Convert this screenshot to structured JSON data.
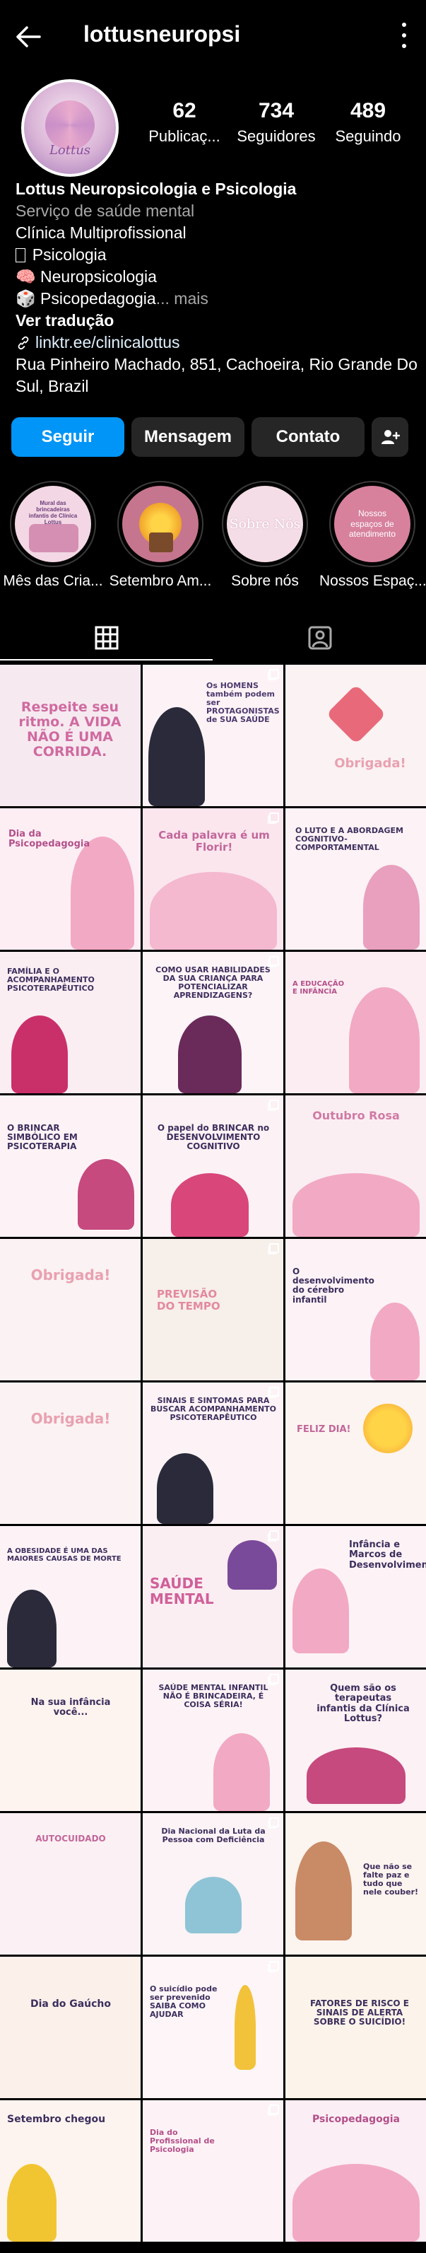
{
  "header": {
    "username": "lottusneuropsi",
    "back_icon": "arrow-left-icon",
    "more_icon": "kebab-menu-icon"
  },
  "stats": {
    "posts_count": "62",
    "posts_label": "Publicaç...",
    "followers_count": "734",
    "followers_label": "Seguidores",
    "following_count": "489",
    "following_label": "Seguindo"
  },
  "bio": {
    "name": "Lottus Neuropsicologia e Psicologia",
    "category": "Serviço de saúde mental",
    "line1": "Clínica Multiprofissional",
    "line2": " Psicologia",
    "line3": "🧠 Neuropsicologia",
    "line4_main": "🎲 Psicopedagogia",
    "line4_more": "... mais",
    "translate": "Ver tradução",
    "link": "linktr.ee/clinicalottus",
    "address": "Rua Pinheiro Machado, 851, Cachoeira, Rio Grande Do Sul, Brazil"
  },
  "actions": {
    "follow": "Seguir",
    "message": "Mensagem",
    "contact": "Contato",
    "add_user_icon": "person-add-icon"
  },
  "highlights": [
    {
      "label": "Mês das Cria...",
      "cover_text": "Mural das brincadeiras infantis de Clínica Lottus"
    },
    {
      "label": "Setembro Am...",
      "cover_text": ""
    },
    {
      "label": "Sobre nós",
      "cover_text": "Sobre Nós"
    },
    {
      "label": "Nossos Espaç...",
      "cover_text": "Nossos espaços de atendimento"
    }
  ],
  "tabs": {
    "grid_icon": "grid-icon",
    "tagged_icon": "tagged-person-icon"
  },
  "posts": [
    {
      "text": "Respeite seu ritmo. A VIDA NÃO É UMA CORRIDA.",
      "bg": "#f6eaf0",
      "fg": "#d06aa0"
    },
    {
      "text": "Os HOMENS também podem ser PROTAGONISTAS de SUA SAÚDE",
      "bg": "#fdf3f6",
      "fg": "#4b3a6e"
    },
    {
      "text": "Obrigada!",
      "bg": "#fbf2f3",
      "fg": "#e9a1b0"
    },
    {
      "text": "Dia da Psicopedagogia",
      "bg": "#fdeef4",
      "fg": "#b3508a"
    },
    {
      "text": "Cada palavra é um Florir!",
      "bg": "#fbe6ee",
      "fg": "#c2679a"
    },
    {
      "text": "O LUTO E A ABORDAGEM COGNITIVO-COMPORTAMENTAL",
      "bg": "#fdf2f5",
      "fg": "#3c2f5e"
    },
    {
      "text": "FAMÍLIA E O ACOMPANHAMENTO PSICOTERAPÊUTICO",
      "bg": "#fbeef3",
      "fg": "#3c2f5e"
    },
    {
      "text": "COMO USAR HABILIDADES DA SUA CRIANÇA PARA POTENCIALIZAR APRENDIZAGENS?",
      "bg": "#fdf4f7",
      "fg": "#3c2f5e"
    },
    {
      "text": "A EDUCAÇÃO E INFÂNCIA",
      "bg": "#fcedf2",
      "fg": "#b3508a"
    },
    {
      "text": "O BRINCAR SIMBÓLICO EM PSICOTERAPIA",
      "bg": "#fdf3f6",
      "fg": "#3c2f5e"
    },
    {
      "text": "O papel do BRINCAR no DESENVOLVIMENTO COGNITIVO",
      "bg": "#fcf1f4",
      "fg": "#3c2f5e"
    },
    {
      "text": "Outubro Rosa",
      "bg": "#fbeef2",
      "fg": "#d07aa5"
    },
    {
      "text": "Obrigada!",
      "bg": "#fbf2f3",
      "fg": "#e9a1b0"
    },
    {
      "text": "PREVISÃO DO TEMPO",
      "bg": "#f6efea",
      "fg": "#e4899f"
    },
    {
      "text": "O desenvolvimento do cérebro infantil",
      "bg": "#fdf3f6",
      "fg": "#3c2f5e"
    },
    {
      "text": "Obrigada!",
      "bg": "#fbf2f3",
      "fg": "#e9a1b0"
    },
    {
      "text": "SINAIS E SINTOMAS PARA BUSCAR ACOMPANHAMENTO PSICOTERAPÊUTICO",
      "bg": "#fdf3f6",
      "fg": "#3c2f5e"
    },
    {
      "text": "FELIZ DIA!",
      "bg": "#fcf4f0",
      "fg": "#c2679a"
    },
    {
      "text": "A OBESIDADE É UMA DAS MAIORES CAUSAS DE MORTE",
      "bg": "#fdf3f6",
      "fg": "#3c2f5e"
    },
    {
      "text": "SAÚDE MENTAL",
      "bg": "#fbeef2",
      "fg": "#d0609a"
    },
    {
      "text": "Infância e Marcos de Desenvolvimento",
      "bg": "#fdf3f6",
      "fg": "#3c2f5e"
    },
    {
      "text": "Na sua infância você...",
      "bg": "#fdf4f0",
      "fg": "#3c2f5e"
    },
    {
      "text": "SAÚDE MENTAL INFANTIL NÃO É BRINCADEIRA, É COISA SÉRIA!",
      "bg": "#fdf3f6",
      "fg": "#3c2f5e"
    },
    {
      "text": "Quem são os terapeutas infantis da Clínica Lottus?",
      "bg": "#fcf1f4",
      "fg": "#3c2f5e"
    },
    {
      "text": "AUTOCUIDADO",
      "bg": "#fbf0f3",
      "fg": "#c2679a"
    },
    {
      "text": "Dia Nacional da Luta da Pessoa com Deficiência",
      "bg": "#fbf3f5",
      "fg": "#3c2f5e"
    },
    {
      "text": "Que não se falte paz e tudo que nele couber!",
      "bg": "#fcf4ee",
      "fg": "#3c2f5e"
    },
    {
      "text": "Dia do Gaúcho",
      "bg": "#fbf0ea",
      "fg": "#3c2f5e"
    },
    {
      "text": "O suicídio pode ser prevenido SAIBA COMO AJUDAR",
      "bg": "#fdf5f7",
      "fg": "#3c2f5e"
    },
    {
      "text": "FATORES DE RISCO E SINAIS DE ALERTA SOBRE O SUICÍDIO!",
      "bg": "#fcf4ea",
      "fg": "#3c2f5e"
    },
    {
      "text": "Setembro chegou",
      "bg": "#fdf4f0",
      "fg": "#3c2f5e"
    },
    {
      "text": "Dia do Profissional de Psicologia",
      "bg": "#fdf3f6",
      "fg": "#b3508a"
    },
    {
      "text": "Psicopedagogia",
      "bg": "#fbeef4",
      "fg": "#b3508a"
    }
  ]
}
